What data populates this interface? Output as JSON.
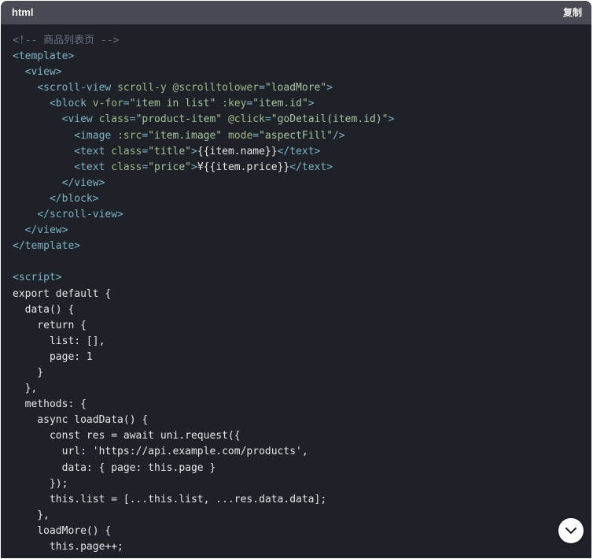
{
  "header": {
    "language": "html",
    "copy_label": "复制"
  },
  "code": {
    "lines": [
      [
        {
          "t": "<!-- 商品列表页 -->",
          "c": "comment"
        }
      ],
      [
        {
          "t": "<template>",
          "c": "tag"
        }
      ],
      [
        {
          "t": "  ",
          "c": "plain"
        },
        {
          "t": "<view>",
          "c": "tag"
        }
      ],
      [
        {
          "t": "    ",
          "c": "plain"
        },
        {
          "t": "<scroll-view ",
          "c": "tag"
        },
        {
          "t": "scroll-y @scrolltolower",
          "c": "attr"
        },
        {
          "t": "=",
          "c": "tag"
        },
        {
          "t": "\"loadMore\"",
          "c": "string"
        },
        {
          "t": ">",
          "c": "tag"
        }
      ],
      [
        {
          "t": "      ",
          "c": "plain"
        },
        {
          "t": "<block ",
          "c": "tag"
        },
        {
          "t": "v-for",
          "c": "attr"
        },
        {
          "t": "=",
          "c": "tag"
        },
        {
          "t": "\"item in list\"",
          "c": "string"
        },
        {
          "t": " ",
          "c": "plain"
        },
        {
          "t": ":key",
          "c": "attr"
        },
        {
          "t": "=",
          "c": "tag"
        },
        {
          "t": "\"item.id\"",
          "c": "string"
        },
        {
          "t": ">",
          "c": "tag"
        }
      ],
      [
        {
          "t": "        ",
          "c": "plain"
        },
        {
          "t": "<view ",
          "c": "tag"
        },
        {
          "t": "class",
          "c": "attr"
        },
        {
          "t": "=",
          "c": "tag"
        },
        {
          "t": "\"product-item\"",
          "c": "string"
        },
        {
          "t": " ",
          "c": "plain"
        },
        {
          "t": "@click",
          "c": "attr"
        },
        {
          "t": "=",
          "c": "tag"
        },
        {
          "t": "\"goDetail(item.id)\"",
          "c": "string"
        },
        {
          "t": ">",
          "c": "tag"
        }
      ],
      [
        {
          "t": "          ",
          "c": "plain"
        },
        {
          "t": "<image ",
          "c": "tag"
        },
        {
          "t": ":src",
          "c": "attr"
        },
        {
          "t": "=",
          "c": "tag"
        },
        {
          "t": "\"item.image\"",
          "c": "string"
        },
        {
          "t": " ",
          "c": "plain"
        },
        {
          "t": "mode",
          "c": "attr"
        },
        {
          "t": "=",
          "c": "tag"
        },
        {
          "t": "\"aspectFill\"",
          "c": "string"
        },
        {
          "t": "/>",
          "c": "tag"
        }
      ],
      [
        {
          "t": "          ",
          "c": "plain"
        },
        {
          "t": "<text ",
          "c": "tag"
        },
        {
          "t": "class",
          "c": "attr"
        },
        {
          "t": "=",
          "c": "tag"
        },
        {
          "t": "\"title\"",
          "c": "string"
        },
        {
          "t": ">",
          "c": "tag"
        },
        {
          "t": "{{item.name}}",
          "c": "plain"
        },
        {
          "t": "</text>",
          "c": "tag"
        }
      ],
      [
        {
          "t": "          ",
          "c": "plain"
        },
        {
          "t": "<text ",
          "c": "tag"
        },
        {
          "t": "class",
          "c": "attr"
        },
        {
          "t": "=",
          "c": "tag"
        },
        {
          "t": "\"price\"",
          "c": "string"
        },
        {
          "t": ">",
          "c": "tag"
        },
        {
          "t": "¥{{item.price}}",
          "c": "plain"
        },
        {
          "t": "</text>",
          "c": "tag"
        }
      ],
      [
        {
          "t": "        ",
          "c": "plain"
        },
        {
          "t": "</view>",
          "c": "tag"
        }
      ],
      [
        {
          "t": "      ",
          "c": "plain"
        },
        {
          "t": "</block>",
          "c": "tag"
        }
      ],
      [
        {
          "t": "    ",
          "c": "plain"
        },
        {
          "t": "</scroll-view>",
          "c": "tag"
        }
      ],
      [
        {
          "t": "  ",
          "c": "plain"
        },
        {
          "t": "</view>",
          "c": "tag"
        }
      ],
      [
        {
          "t": "</template>",
          "c": "tag"
        }
      ],
      [
        {
          "t": "",
          "c": "plain"
        }
      ],
      [
        {
          "t": "<script>",
          "c": "tag"
        }
      ],
      [
        {
          "t": "export default {",
          "c": "plain"
        }
      ],
      [
        {
          "t": "  data() {",
          "c": "plain"
        }
      ],
      [
        {
          "t": "    return {",
          "c": "plain"
        }
      ],
      [
        {
          "t": "      list: [],",
          "c": "plain"
        }
      ],
      [
        {
          "t": "      page: 1",
          "c": "plain"
        }
      ],
      [
        {
          "t": "    }",
          "c": "plain"
        }
      ],
      [
        {
          "t": "  },",
          "c": "plain"
        }
      ],
      [
        {
          "t": "  methods: {",
          "c": "plain"
        }
      ],
      [
        {
          "t": "    async loadData() {",
          "c": "plain"
        }
      ],
      [
        {
          "t": "      const res = await uni.request({",
          "c": "plain"
        }
      ],
      [
        {
          "t": "        url: 'https://api.example.com/products',",
          "c": "plain"
        }
      ],
      [
        {
          "t": "        data: { page: this.page }",
          "c": "plain"
        }
      ],
      [
        {
          "t": "      });",
          "c": "plain"
        }
      ],
      [
        {
          "t": "      this.list = [...this.list, ...res.data.data];",
          "c": "plain"
        }
      ],
      [
        {
          "t": "    },",
          "c": "plain"
        }
      ],
      [
        {
          "t": "    loadMore() {",
          "c": "plain"
        }
      ],
      [
        {
          "t": "      this.page++;",
          "c": "plain"
        }
      ]
    ]
  },
  "scroll_button": {
    "icon": "chevron-down-icon"
  }
}
